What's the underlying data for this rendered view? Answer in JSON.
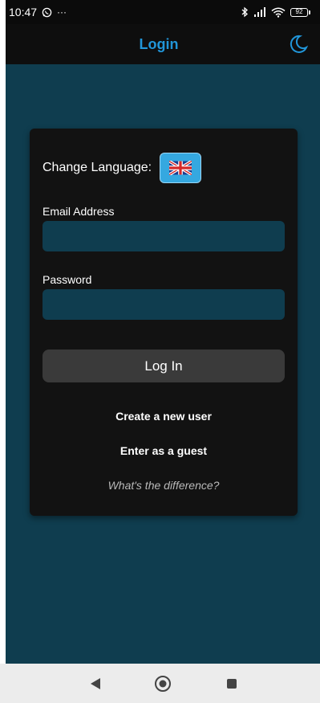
{
  "status_bar": {
    "time": "10:47",
    "more": "···",
    "battery": "92"
  },
  "header": {
    "title": "Login"
  },
  "card": {
    "change_language_label": "Change Language:",
    "flag": "uk-flag",
    "email_label": "Email Address",
    "email_value": "",
    "password_label": "Password",
    "password_value": "",
    "login_button": "Log In",
    "create_user_link": "Create a new user",
    "guest_link": "Enter as a guest",
    "difference_link": "What's the difference?"
  },
  "colors": {
    "accent": "#2196d9",
    "background": "#0f3d4f",
    "card": "#121212",
    "button": "#3a3a3a"
  },
  "icons": {
    "theme": "moon-icon",
    "nav_back": "triangle-back-icon",
    "nav_home": "circle-home-icon",
    "nav_recents": "square-recents-icon"
  }
}
